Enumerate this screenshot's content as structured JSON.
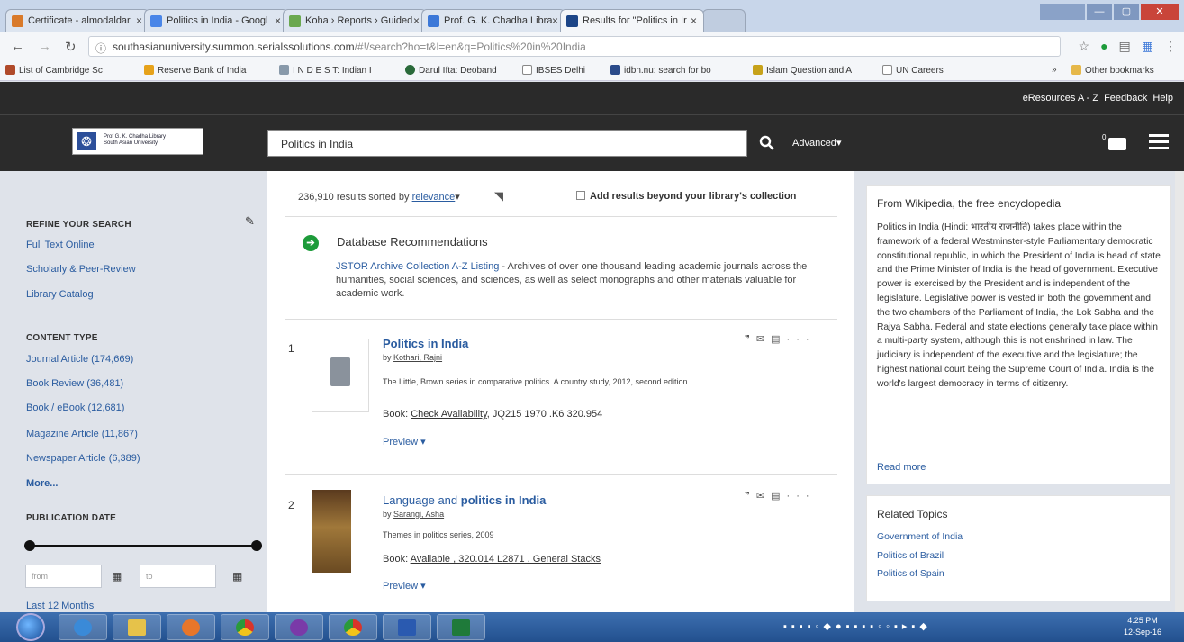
{
  "browser": {
    "tabs": [
      {
        "label": "Certificate - almodaldar",
        "color": "#d97a2a"
      },
      {
        "label": "Politics in India - Googl",
        "color": "#4a86e8"
      },
      {
        "label": "Koha › Reports › Guided",
        "color": "#6aa84f"
      },
      {
        "label": "Prof. G. K. Chadha Libra",
        "color": "#3c78d8"
      },
      {
        "label": "Results for \"Politics in Ir",
        "color": "#1c4587"
      }
    ],
    "url_host": "southasianuniversity.summon.serialssolutions.com",
    "url_rest": "/#!/search?ho=t&l=en&q=Politics%20in%20India",
    "bookmarks": [
      {
        "label": "List of Cambridge Sc",
        "color": "#b04a2a"
      },
      {
        "label": "Reserve Bank of India",
        "color": "#e6a21a"
      },
      {
        "label": "I N D E S T: Indian I",
        "color": "#8899aa"
      },
      {
        "label": "Darul Ifta: Deoband",
        "color": "#2a6a3a"
      },
      {
        "label": "IBSES Delhi",
        "color": "#ffffff"
      },
      {
        "label": "idbn.nu: search for bo",
        "color": "#2a4a8a"
      },
      {
        "label": "Islam Question and A",
        "color": "#c7a21a"
      },
      {
        "label": "UN Careers",
        "color": "#ffffff"
      },
      {
        "label": "Other bookmarks",
        "color": "#e6b84a"
      }
    ]
  },
  "site": {
    "top_links": [
      "eResources A - Z",
      "Feedback",
      "Help"
    ],
    "logo_line1": "Prof G. K. Chadha Library",
    "logo_line2": "South Asian University",
    "search_value": "Politics in India",
    "advanced": "Advanced",
    "cart_count": "0"
  },
  "sidebar": {
    "refine_heading": "REFINE YOUR SEARCH",
    "refine_links": [
      "Full Text Online",
      "Scholarly & Peer-Review",
      "Library Catalog"
    ],
    "content_heading": "CONTENT TYPE",
    "content_links": [
      "Journal Article (174,669)",
      "Book Review (36,481)",
      "Book / eBook (12,681)",
      "Magazine Article (11,867)",
      "Newspaper Article (6,389)"
    ],
    "more": "More...",
    "pubdate_heading": "PUBLICATION DATE",
    "from_placeholder": "from",
    "to_placeholder": "to",
    "last12": "Last 12 Months"
  },
  "results_bar": {
    "count_text": "236,910 results sorted by",
    "sort": "relevance",
    "beyond": "Add results beyond your library's collection"
  },
  "db_rec": {
    "title": "Database Recommendations",
    "link": "JSTOR Archive Collection A-Z Listing",
    "desc": " - Archives of over one thousand leading academic journals across the humanities, social sciences, and sciences, as well as select monographs and other materials valuable for academic work."
  },
  "results": [
    {
      "num": "1",
      "title_pre": "",
      "title_bold": "Politics in India",
      "by_label": "by",
      "author": "Kothari, Rajni",
      "series": "The Little, Brown series in comparative politics. A country study, 2012, second edition",
      "avail_label": "Book:",
      "avail_link": "Check Availability",
      "avail_rest": ", JQ215 1970 .K6 320.954",
      "preview": "Preview"
    },
    {
      "num": "2",
      "title_pre": "Language and ",
      "title_bold": "politics in India",
      "by_label": "by",
      "author": "Sarangi, Asha",
      "series": "Themes in politics series, 2009",
      "avail_label": "Book:",
      "avail_link": "Available , 320.014 L2871 , General Stacks",
      "avail_rest": "",
      "preview": "Preview"
    }
  ],
  "wiki": {
    "heading": "From Wikipedia, the free encyclopedia",
    "body": "Politics in India (Hindi: भारतीय राजनीति) takes place within the framework of a federal Westminster-style Parliamentary democratic constitutional republic, in which the President of India is head of state and the Prime Minister of India is the head of government. Executive power is exercised by the President and is independent of the legislature. Legislative power is vested in both the government and the two chambers of the Parliament of India, the Lok Sabha and the Rajya Sabha. Federal and state elections generally take place within a multi-party system, although this is not enshrined in law. The judiciary is independent of the executive and the legislature; the highest national court being the Supreme Court of India. India is the world's largest democracy in terms of citizenry.",
    "read_more": "Read more"
  },
  "related": {
    "heading": "Related Topics",
    "links": [
      "Government of India",
      "Politics of Brazil",
      "Politics of Spain"
    ]
  },
  "taskbar": {
    "time": "4:25 PM",
    "date": "12-Sep-16"
  }
}
